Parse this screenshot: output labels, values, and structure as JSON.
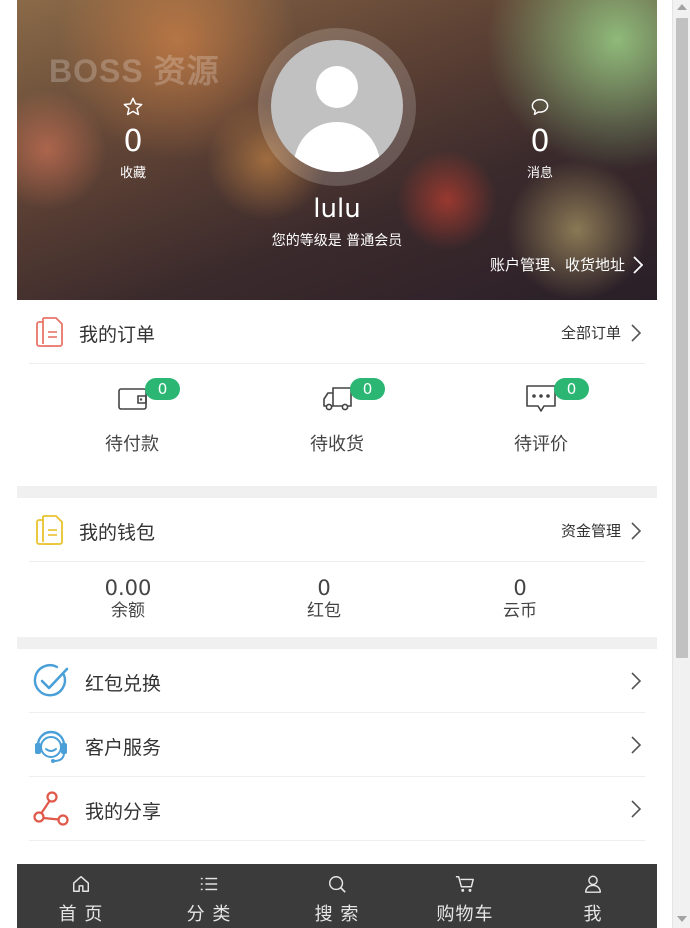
{
  "header": {
    "watermark": "BOSS 资源",
    "favorites": {
      "count": "0",
      "label": "收藏",
      "icon": "star-icon"
    },
    "messages": {
      "count": "0",
      "label": "消息",
      "icon": "chat-bubble-icon"
    },
    "avatar_icon": "user-avatar-icon",
    "username": "lulu",
    "member_level": "您的等级是 普通会员",
    "account_link": "账户管理、收货地址"
  },
  "orders": {
    "title": "我的订单",
    "link": "全部订单",
    "items": [
      {
        "label": "待付款",
        "badge": "0",
        "icon": "wallet-icon"
      },
      {
        "label": "待收货",
        "badge": "0",
        "icon": "delivery-truck-icon"
      },
      {
        "label": "待评价",
        "badge": "0",
        "icon": "comment-icon"
      }
    ]
  },
  "wallet": {
    "title": "我的钱包",
    "link": "资金管理",
    "items": [
      {
        "value": "0.00",
        "label": "余额"
      },
      {
        "value": "0",
        "label": "红包"
      },
      {
        "value": "0",
        "label": "云币"
      }
    ]
  },
  "menu": {
    "items": [
      {
        "label": "红包兑换",
        "icon": "check-circle-icon"
      },
      {
        "label": "客户服务",
        "icon": "headset-icon"
      },
      {
        "label": "我的分享",
        "icon": "share-icon"
      }
    ]
  },
  "bottom_nav": {
    "items": [
      {
        "label": "首 页",
        "icon": "home-icon"
      },
      {
        "label": "分 类",
        "icon": "list-icon"
      },
      {
        "label": "搜 索",
        "icon": "search-icon"
      },
      {
        "label": "购物车",
        "icon": "cart-icon"
      },
      {
        "label": "我",
        "icon": "user-icon"
      }
    ]
  },
  "colors": {
    "badge": "#2bb673",
    "nav_background": "#3b3b3b",
    "order_icon": "#e8766a",
    "wallet_icon": "#e8c22e",
    "menu_check_icon": "#4a9fd8",
    "menu_headset_icon": "#4a9fd8",
    "menu_share_icon": "#e0584a"
  }
}
